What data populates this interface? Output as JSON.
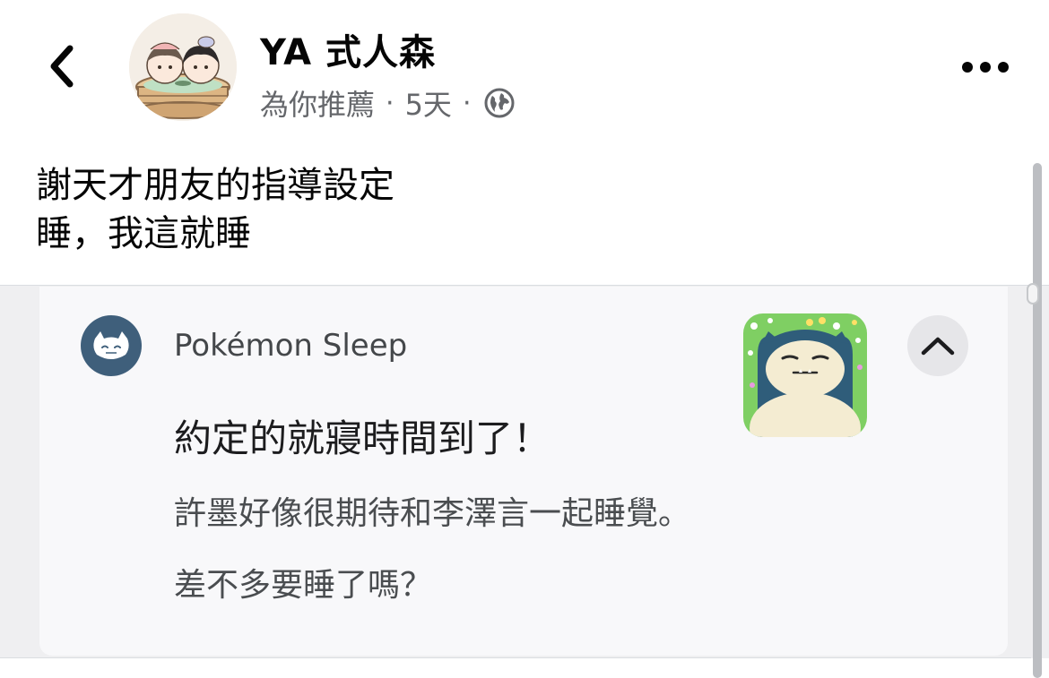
{
  "header": {
    "author": "YA 式人森",
    "meta_label": "為你推薦",
    "meta_separator": "·",
    "time": "5天",
    "privacy_icon": "globe-icon",
    "back_icon": "chevron-left-icon",
    "more_icon": "more-horizontal-icon"
  },
  "post": {
    "text_line_1": "謝天才朋友的指導設定",
    "text_line_2": "睡，我這就睡"
  },
  "notification": {
    "app_name": "Pokémon Sleep",
    "title": "約定的就寢時間到了！",
    "body_line_1": "許墨好像很期待和李澤言一起睡覺。",
    "body_line_2": "差不多要睡了嗎？",
    "collapse_icon": "chevron-up-icon"
  },
  "colors": {
    "app_icon_bg": "#3f5f7b",
    "meta_gray": "#65676b",
    "card_bg": "#f8f8fa"
  }
}
